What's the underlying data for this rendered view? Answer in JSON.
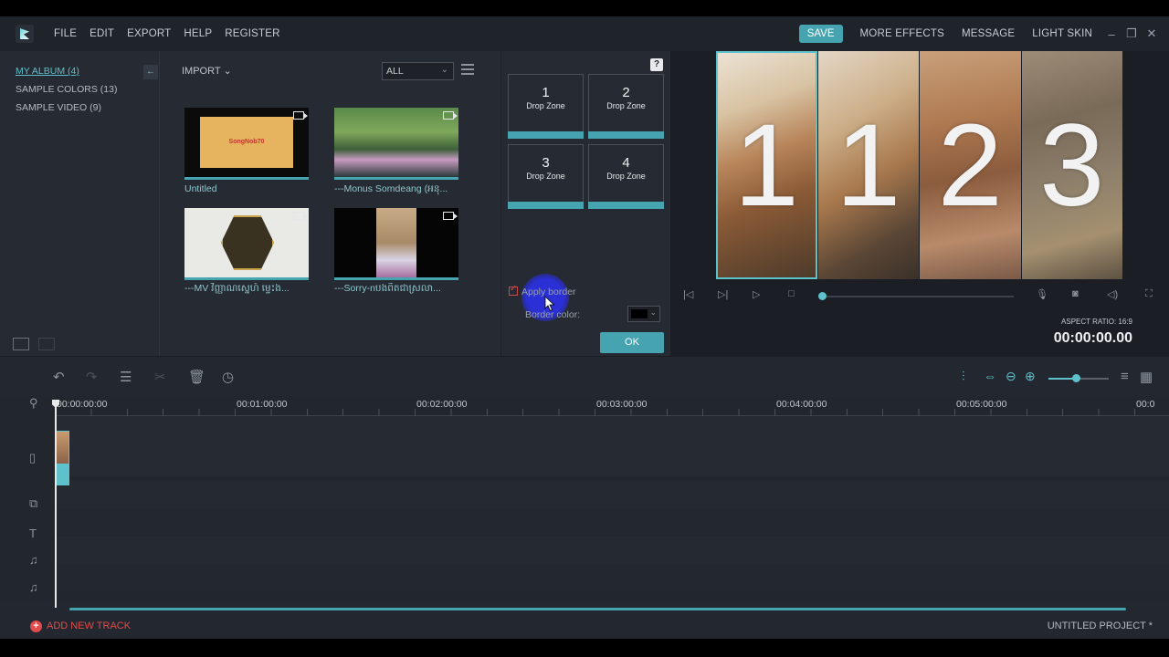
{
  "menu": {
    "items": [
      "FILE",
      "EDIT",
      "EXPORT",
      "HELP",
      "REGISTER"
    ],
    "save_label": "SAVE",
    "right_items": [
      "MORE EFFECTS",
      "MESSAGE",
      "LIGHT SKIN"
    ]
  },
  "library": {
    "albums": [
      {
        "label": "MY ALBUM (4)",
        "active": true
      },
      {
        "label": "SAMPLE COLORS (13)",
        "active": false
      },
      {
        "label": "SAMPLE VIDEO (9)",
        "active": false
      }
    ],
    "import_label": "IMPORT",
    "filter_value": "ALL",
    "thumbnails": [
      {
        "label": "Untitled",
        "overlay_text": "SongNob70"
      },
      {
        "label": "---Monus Somdeang (អនុ...",
        "overlay_text": ""
      },
      {
        "label": "---MV វិញ្ញាណស្នេហ៍ ម្ទេះង...",
        "overlay_text": ""
      },
      {
        "label": "---Sorry-nបងពិតជាស្រលា...",
        "overlay_text": ""
      }
    ]
  },
  "split_screen": {
    "help": "?",
    "zones": [
      {
        "number": "1",
        "label": "Drop Zone"
      },
      {
        "number": "2",
        "label": "Drop Zone"
      },
      {
        "number": "3",
        "label": "Drop Zone"
      },
      {
        "number": "4",
        "label": "Drop Zone"
      }
    ],
    "apply_border_label": "Apply border",
    "apply_border_checked": true,
    "border_color_label": "Border color:",
    "border_color": "#000000",
    "ok_label": "OK"
  },
  "preview": {
    "panels": [
      "1",
      "1",
      "2",
      "3"
    ],
    "aspect_ratio": "ASPECT RATIO: 16:9",
    "timecode": "00:00:00.00"
  },
  "timeline": {
    "ruler": [
      "00:00:00:00",
      "00:01:00:00",
      "00:02:00:00",
      "00:03:00:00",
      "00:04:00:00",
      "00:05:00:00",
      "00:0"
    ]
  },
  "footer": {
    "add_track_label": "ADD NEW TRACK",
    "project_name": "UNTITLED PROJECT *"
  },
  "colors": {
    "accent": "#46a4b1",
    "danger": "#e24b4b"
  }
}
